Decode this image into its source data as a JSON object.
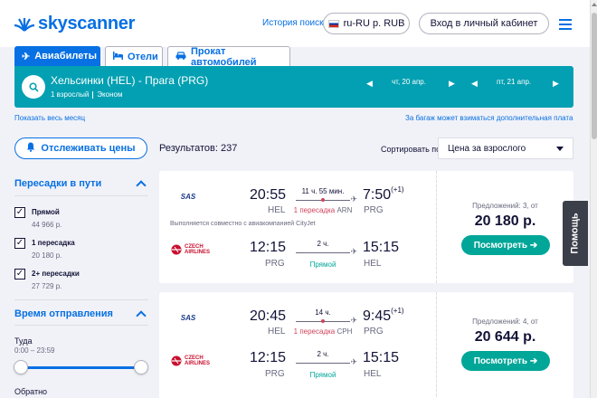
{
  "header": {
    "brand": "skyscanner",
    "history_link": "История поиска",
    "locale_label": "ru-RU р. RUB",
    "login_label": "Вход в личный кабинет"
  },
  "tabs": [
    {
      "label": "Авиабилеты",
      "icon": "plane-icon"
    },
    {
      "label": "Отели",
      "icon": "bed-icon"
    },
    {
      "label": "Прокат автомобилей",
      "icon": "car-icon"
    }
  ],
  "search": {
    "route": "Хельсинки (HEL) - Прага (PRG)",
    "passengers": "1 взрослый",
    "cabin": "Эконом",
    "outbound_date": "чт, 20 апр.",
    "return_date": "пт, 21 апр."
  },
  "links": {
    "show_month": "Показать весь месяц",
    "baggage_note": "За багаж может взиматься дополнительная плата"
  },
  "toolbar": {
    "track_label": "Отслеживать цены",
    "results": "Результатов: 237",
    "sort_label": "Сортировать по",
    "sort_value": "Цена за взрослого"
  },
  "filters": {
    "stops_title": "Пересадки в пути",
    "stops": [
      {
        "label": "Прямой",
        "price": "44 966 р.",
        "checked": true
      },
      {
        "label": "1 пересадка",
        "price": "20 180 р.",
        "checked": true
      },
      {
        "label": "2+ пересадки",
        "price": "27 729 р.",
        "checked": true
      }
    ],
    "departure_title": "Время отправления",
    "outbound_label": "Туда",
    "outbound_range": "0:00 – 23:59",
    "return_label": "Обратно"
  },
  "results": [
    {
      "outbound": {
        "dep_time": "20:55",
        "dep_code": "HEL",
        "duration": "11 ч. 55 мин.",
        "stops": "1 пересадка",
        "via": "ARN",
        "arr_time": "7:50",
        "plus_day": "(+1)",
        "arr_code": "PRG"
      },
      "note": "Выполняется совместно с авиакомпанией CityJet",
      "inbound": {
        "dep_time": "12:15",
        "dep_code": "PRG",
        "duration": "2 ч.",
        "stops": "Прямой",
        "arr_time": "15:15",
        "arr_code": "HEL"
      },
      "offers": "Предложений: 3, от",
      "price": "20 180 р.",
      "button": "Посмотреть ➔"
    },
    {
      "outbound": {
        "dep_time": "20:45",
        "dep_code": "HEL",
        "duration": "14 ч.",
        "stops": "1 пересадка",
        "via": "CPH",
        "arr_time": "9:45",
        "plus_day": "(+1)",
        "arr_code": "PRG"
      },
      "inbound": {
        "dep_time": "12:15",
        "dep_code": "PRG",
        "duration": "2 ч.",
        "stops": "Прямой",
        "arr_time": "15:15",
        "arr_code": "HEL"
      },
      "offers": "Предложений: 4, от",
      "price": "20 644 р.",
      "button": "Посмотреть ➔"
    }
  ],
  "airlines": {
    "sas": "SAS",
    "czech": [
      "CZECH",
      "AIRLINES"
    ]
  },
  "help_label": "Помощь",
  "colors": {
    "primary": "#0770e3",
    "search_bar": "#02a0b2",
    "cta": "#00a698",
    "stop_red": "#d1435b"
  }
}
